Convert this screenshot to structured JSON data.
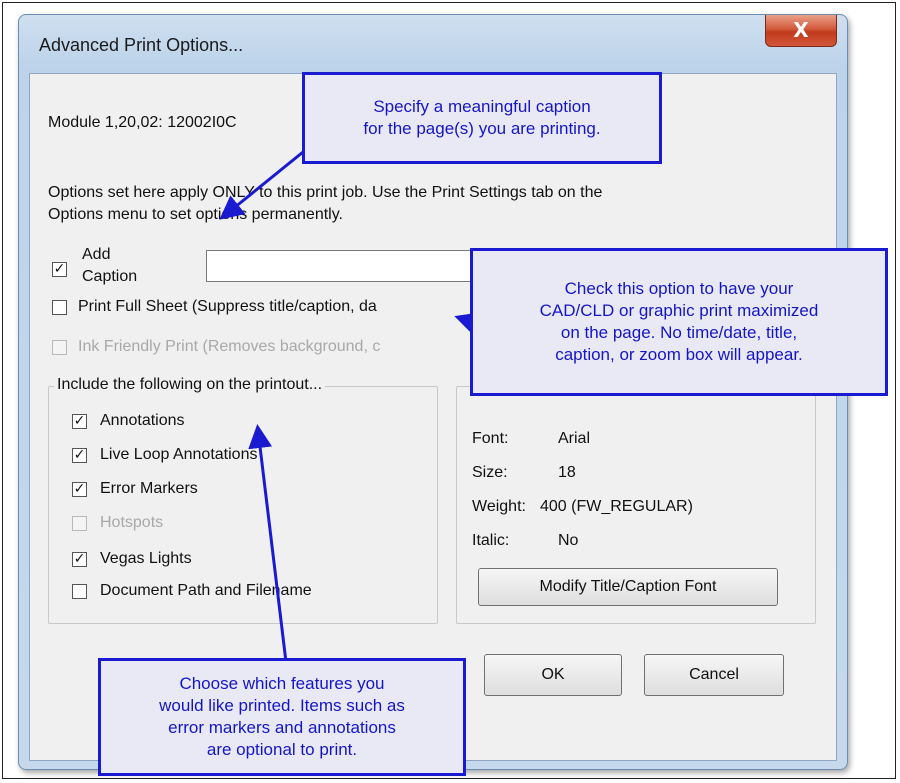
{
  "window": {
    "title": "Advanced Print Options...",
    "close_glyph": "X"
  },
  "module_line": "Module 1,20,02: 12002I0C",
  "info_line1": "Options set here apply ONLY to this print job. Use the Print Settings tab on the",
  "info_line2": "Options menu to set options permanently.",
  "add_caption": {
    "label_line1": "Add",
    "label_line2": "Caption",
    "checked": true,
    "value": ""
  },
  "print_full_sheet": {
    "label": "Print Full Sheet (Suppress title/caption, da",
    "checked": false
  },
  "ink_friendly": {
    "label": "Ink Friendly Print (Removes background, c",
    "checked": false,
    "disabled": true
  },
  "include_group": {
    "label": "Include the following on the printout...",
    "items": [
      {
        "label": "Annotations",
        "checked": true,
        "disabled": false
      },
      {
        "label": "Live Loop Annotations",
        "checked": true,
        "disabled": false
      },
      {
        "label": "Error Markers",
        "checked": true,
        "disabled": false
      },
      {
        "label": "Hotspots",
        "checked": false,
        "disabled": true
      },
      {
        "label": "Vegas Lights",
        "checked": true,
        "disabled": false
      },
      {
        "label": "Document Path and Filename",
        "checked": false,
        "disabled": false
      }
    ]
  },
  "font_group": {
    "font_label": "Font:",
    "font_value": "Arial",
    "size_label": "Size:",
    "size_value": "18",
    "weight_label": "Weight:",
    "weight_value": "400 (FW_REGULAR)",
    "italic_label": "Italic:",
    "italic_value": "No",
    "modify_button": "Modify Title/Caption Font"
  },
  "buttons": {
    "ok": "OK",
    "cancel": "Cancel"
  },
  "callouts": {
    "caption": "Specify a meaningful caption\nfor the page(s) you are printing.",
    "full_sheet": "Check this option to have your\nCAD/CLD or graphic print maximized\non the page.  No time/date, title,\ncaption, or zoom box will appear.",
    "features": "Choose which features you\nwould like printed.  Items such as\nerror markers and annotations\nare optional to print."
  },
  "check_glyph": "✓",
  "colors": {
    "callout_border": "#1a1ad0",
    "callout_text": "#1515c8",
    "callout_fill": "#e9e9f5"
  }
}
